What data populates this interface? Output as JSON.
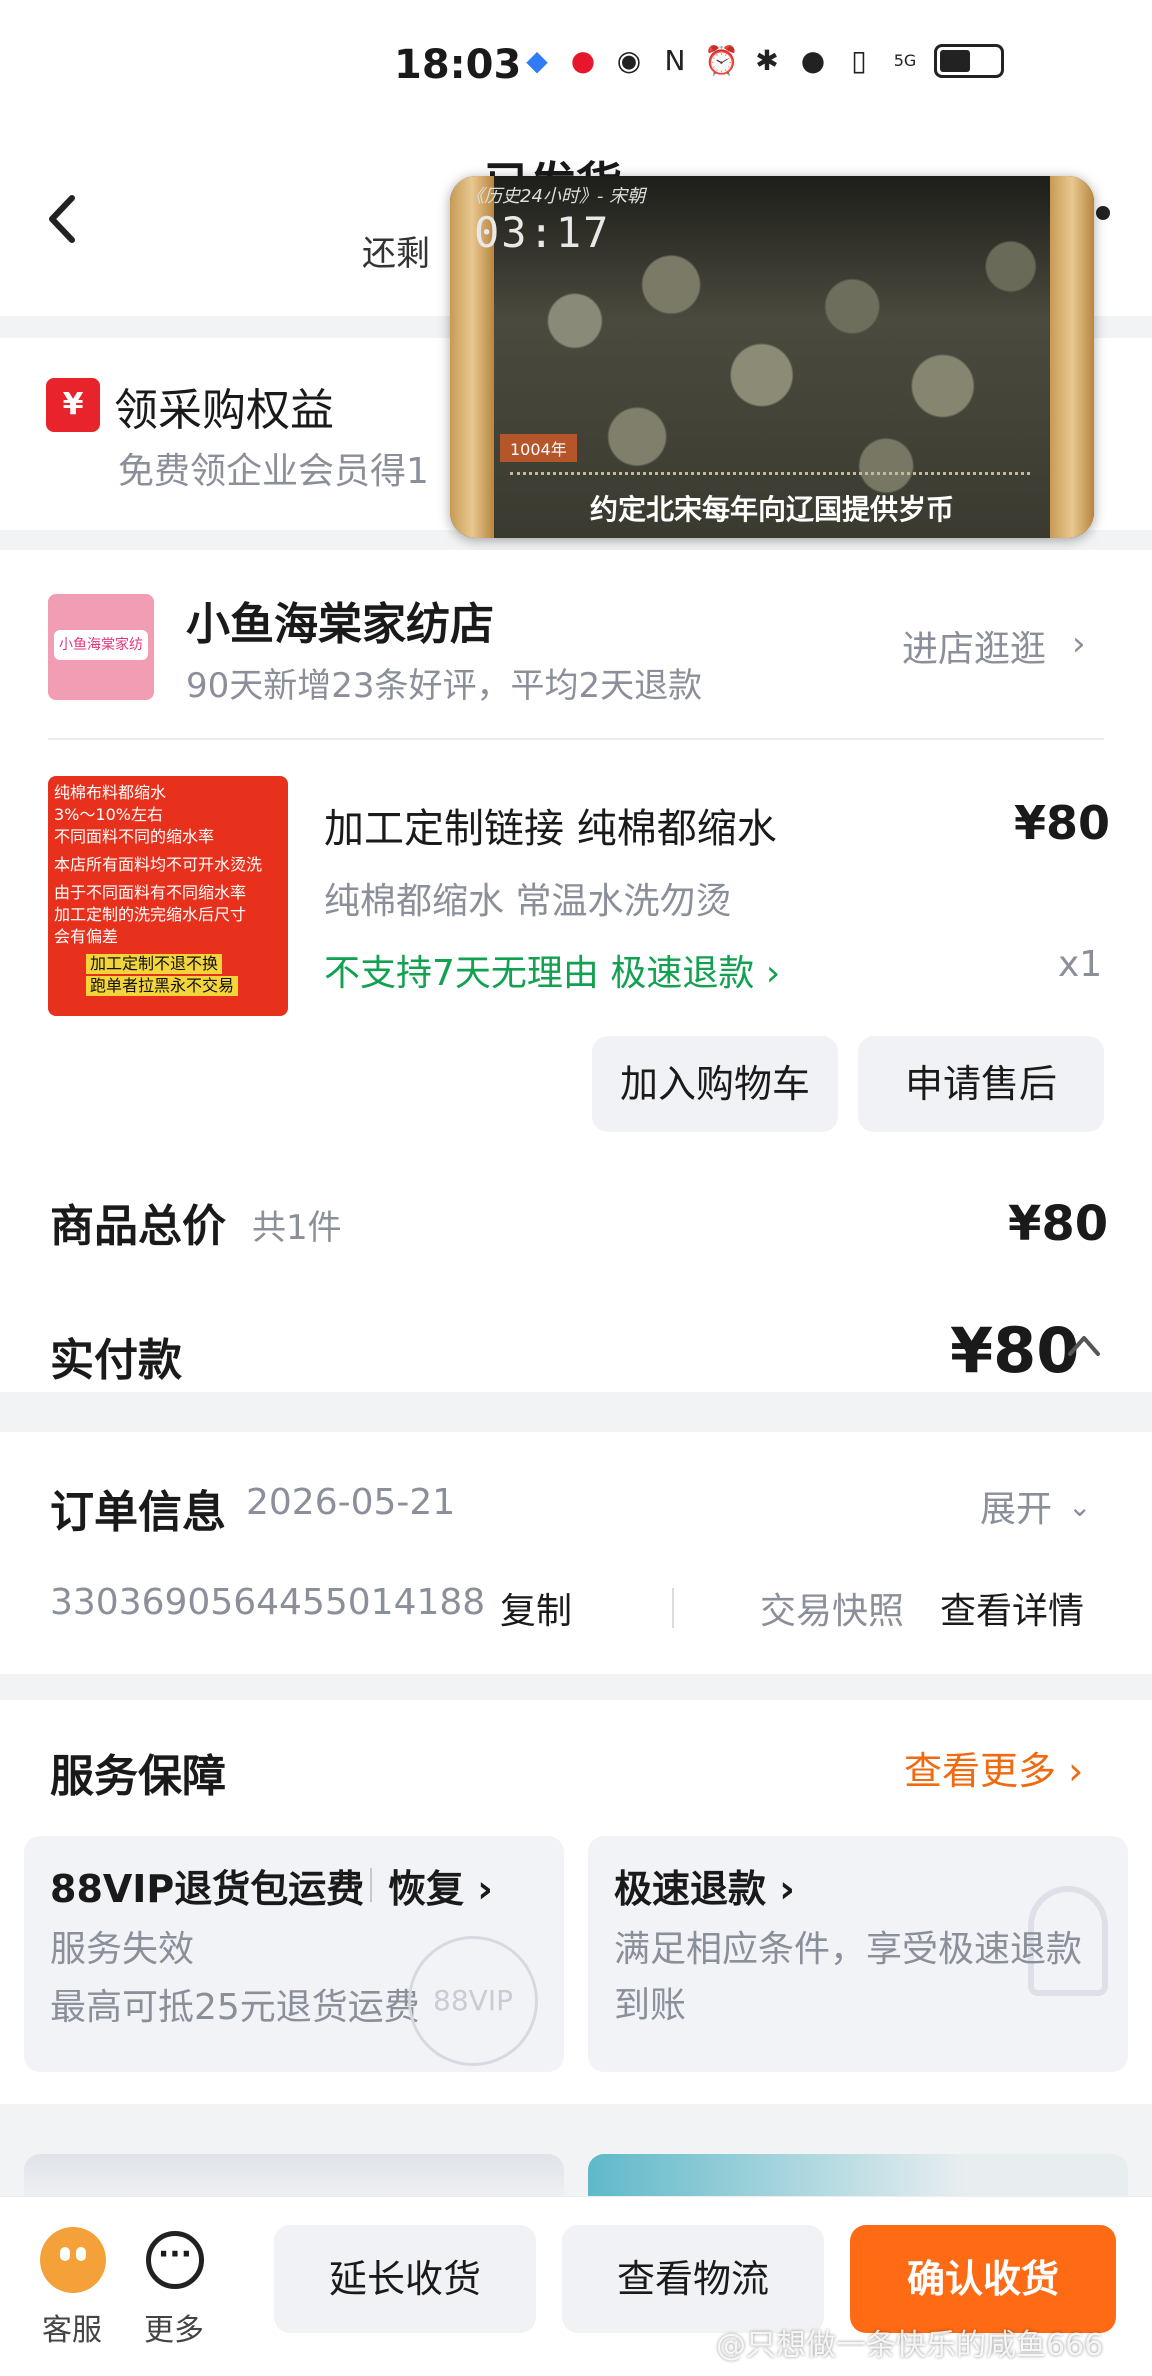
{
  "status_bar": {
    "time": "18:03",
    "network": "5G"
  },
  "header": {
    "title": "已发货",
    "subtitle": "还剩"
  },
  "benefit": {
    "icon_glyph": "¥",
    "title": "领采购权益",
    "subtitle": "免费领企业会员得1"
  },
  "video": {
    "top_label": "《历史24小时》- 宋朝",
    "timer": "03:17",
    "year": "1004年",
    "caption": "约定北宋每年向辽国提供岁币"
  },
  "shop": {
    "logo_text": "小鱼海棠家纺",
    "name": "小鱼海棠家纺店",
    "stats": "90天新增23条好评，平均2天退款",
    "enter_label": "进店逛逛"
  },
  "product": {
    "image_lines": [
      "纯棉布料都缩水",
      "3%～10%左右",
      "不同面料不同的缩水率",
      "本店所有面料均不可开水烫洗",
      "由于不同面料有不同缩水率",
      "加工定制的洗完缩水后尺寸",
      "会有偏差"
    ],
    "image_highlight": [
      "加工定制不退不换",
      "跑单者拉黑永不交易"
    ],
    "title": "加工定制链接 纯棉都缩水",
    "price": "¥80",
    "spec": "纯棉都缩水 常温水洗勿烫",
    "tags": "不支持7天无理由  极速退款",
    "quantity": "x1",
    "add_cart": "加入购物车",
    "after_sale": "申请售后"
  },
  "summary": {
    "total_label": "商品总价",
    "count": "共1件",
    "total_price": "¥80",
    "paid_label": "实付款",
    "paid_price": "¥80"
  },
  "order": {
    "title": "订单信息",
    "date": "2026-05-21",
    "expand": "展开",
    "number": "3303690564455014188",
    "copy": "复制",
    "snapshot": "交易快照",
    "details": "查看详情"
  },
  "service": {
    "title": "服务保障",
    "more": "查看更多",
    "items": [
      {
        "title": "88VIP退货包运费",
        "action": "恢复",
        "line2": "服务失效",
        "line3": "最高可抵25元退货运费",
        "stamp": "88VIP"
      },
      {
        "title": "极速退款",
        "line2": "满足相应条件，享受极速退款",
        "line3": "到账"
      }
    ]
  },
  "bottom_bar": {
    "customer_service": "客服",
    "more": "更多",
    "more_glyph": "···",
    "extend": "延长收货",
    "logistics": "查看物流",
    "confirm": "确认收货"
  },
  "watermark": "@只想做一条快乐的咸鱼666",
  "colors": {
    "accent": "#ff6a14",
    "green": "#12a150",
    "red": "#e8232c"
  }
}
